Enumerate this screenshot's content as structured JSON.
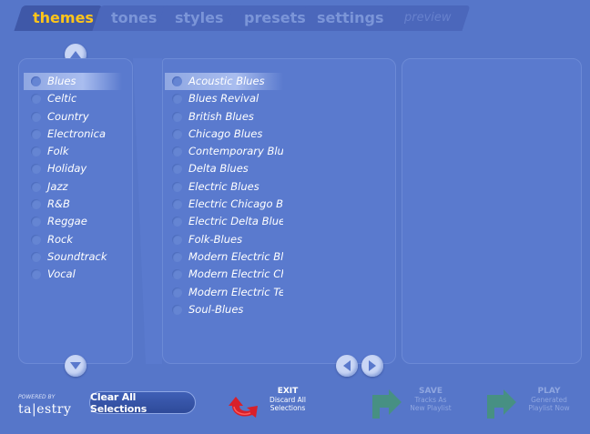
{
  "tabs": [
    {
      "label": "themes",
      "state": "active"
    },
    {
      "label": "tones",
      "state": "normal"
    },
    {
      "label": "styles",
      "state": "normal"
    },
    {
      "label": "presets",
      "state": "normal"
    },
    {
      "label": "settings",
      "state": "normal"
    },
    {
      "label": "preview",
      "state": "disabled"
    }
  ],
  "themes": [
    {
      "label": "Blues",
      "selected": true
    },
    {
      "label": "Celtic"
    },
    {
      "label": "Country"
    },
    {
      "label": "Electronica"
    },
    {
      "label": "Folk"
    },
    {
      "label": "Holiday"
    },
    {
      "label": "Jazz"
    },
    {
      "label": "R&B"
    },
    {
      "label": "Reggae"
    },
    {
      "label": "Rock"
    },
    {
      "label": "Soundtrack"
    },
    {
      "label": "Vocal"
    }
  ],
  "subthemes": [
    {
      "label": "Acoustic Blues",
      "selected": true
    },
    {
      "label": "Blues Revival"
    },
    {
      "label": "British Blues"
    },
    {
      "label": "Chicago Blues"
    },
    {
      "label": "Contemporary Blues"
    },
    {
      "label": "Delta Blues"
    },
    {
      "label": "Electric Blues"
    },
    {
      "label": "Electric Chicago Blues"
    },
    {
      "label": "Electric Delta Blues"
    },
    {
      "label": "Folk-Blues"
    },
    {
      "label": "Modern Electric Blues"
    },
    {
      "label": "Modern Electric Chicago Blues"
    },
    {
      "label": "Modern Electric Texas Blues"
    },
    {
      "label": "Soul-Blues"
    }
  ],
  "logo": {
    "powered_by": "POWERED BY",
    "brand": "ta|estry"
  },
  "clear_button": "Clear All Selections",
  "exit": {
    "title": "EXIT",
    "line1": "Discard All",
    "line2": "Selections"
  },
  "save": {
    "title": "SAVE",
    "line1": "Tracks As",
    "line2": "New Playlist"
  },
  "play": {
    "title": "PLAY",
    "line1": "Generated",
    "line2": "Playlist Now"
  },
  "icons": {
    "scroll_up": "arrow-up-icon",
    "scroll_down": "arrow-down-icon",
    "page_prev": "arrow-left-icon",
    "page_next": "arrow-right-icon"
  },
  "colors": {
    "accent_tab": "#ffc51a",
    "background": "#5676c9",
    "exit_arrow": "#d8202a",
    "action_arrow": "#3ca64a"
  }
}
